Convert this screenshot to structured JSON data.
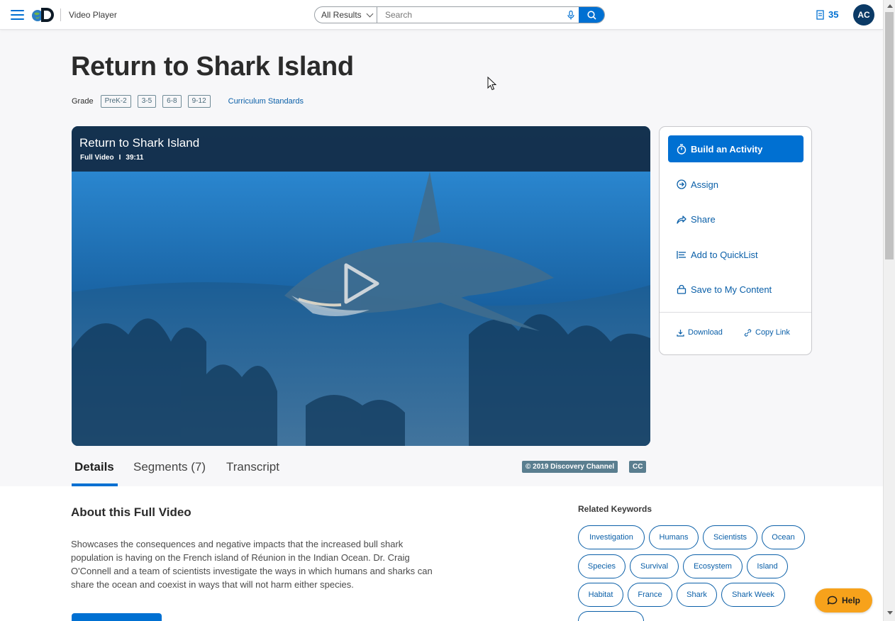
{
  "header": {
    "app_title": "Video Player",
    "search_scope": "All Results",
    "search_placeholder": "Search",
    "notification_count": "35",
    "avatar_initials": "AC"
  },
  "page": {
    "title": "Return to Shark Island",
    "grade_label": "Grade",
    "grades": [
      "PreK-2",
      "3-5",
      "6-8",
      "9-12"
    ],
    "curriculum_link": "Curriculum Standards"
  },
  "video": {
    "title": "Return to Shark Island",
    "type": "Full Video",
    "separator": "I",
    "duration": "39:11"
  },
  "actions": {
    "build": "Build an Activity",
    "assign": "Assign",
    "share": "Share",
    "quicklist": "Add to QuickList",
    "save": "Save to My Content",
    "download": "Download",
    "copy_link": "Copy Link"
  },
  "tabs": [
    "Details",
    "Segments (7)",
    "Transcript"
  ],
  "badges": {
    "copyright": "© 2019 Discovery Channel",
    "cc": "CC"
  },
  "about": {
    "title": "About this Full Video",
    "description": "Showcases the consequences and negative impacts that the increased bull shark population is having on the French island of Réunion in the Indian Ocean. Dr. Craig O'Connell and a team of scientists investigate the ways in which humans and sharks can share the ocean and coexist in ways that will not harm either species."
  },
  "keywords": {
    "title": "Related Keywords",
    "items": [
      "Investigation",
      "Humans",
      "Scientists",
      "Ocean",
      "Species",
      "Survival",
      "Ecosystem",
      "Island",
      "Habitat",
      "France",
      "Shark",
      "Shark Week"
    ]
  },
  "help": {
    "label": "Help"
  },
  "colors": {
    "primary": "#0070d2",
    "link": "#0a5fa8",
    "avatar_bg": "#0b3a66",
    "help_bg": "#f7a21b",
    "badge_bg": "#5a7e8f"
  }
}
